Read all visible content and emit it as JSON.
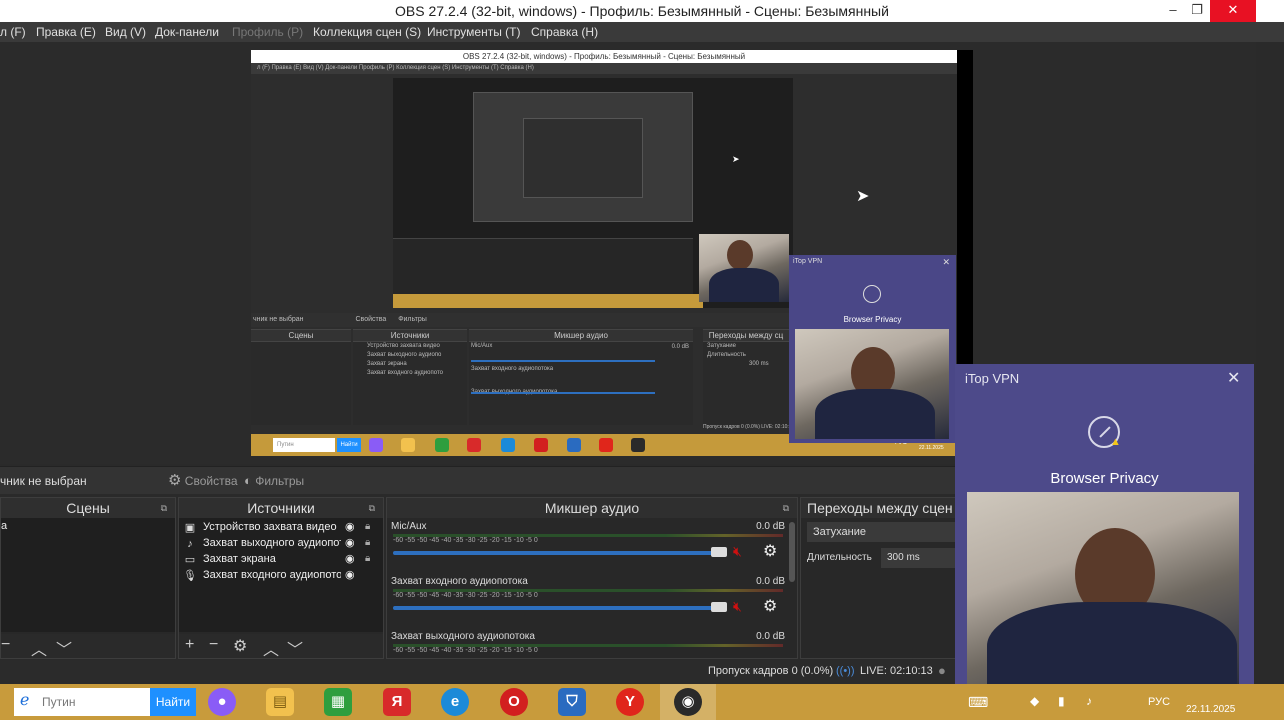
{
  "window": {
    "title": "OBS 27.2.4 (32-bit, windows) - Профиль: Безымянный - Сцены: Безымянный",
    "minimize": "–",
    "restore": "❐",
    "close": "✕"
  },
  "menu": [
    {
      "label": "л (F)",
      "disabled": false
    },
    {
      "label": "Правка (E)",
      "disabled": false
    },
    {
      "label": "Вид (V)",
      "disabled": false
    },
    {
      "label": "Док-панели",
      "disabled": false
    },
    {
      "label": "Профиль (P)",
      "disabled": true
    },
    {
      "label": "Коллекция сцен (S)",
      "disabled": false
    },
    {
      "label": "Инструменты (T)",
      "disabled": false
    },
    {
      "label": "Справка (H)",
      "disabled": false
    }
  ],
  "nested": {
    "title": "OBS 27.2.4 (32-bit, windows) - Профиль: Безымянный - Сцены: Безымянный",
    "menu": "л (F)   Правка (E)   Вид (V)   Док-панели   Профиль (P)   Коллекция сцен (S)   Инструменты (T)   Справка (H)",
    "source_label": "чник не выбран",
    "properties": "Свойства",
    "filters": "Фильтры",
    "scenes": "Сцены",
    "sources": "Источники",
    "mixer": "Микшер аудио",
    "transitions": "Переходы между сц",
    "source_items": [
      "Устройство захвата видео",
      "Захват выходного аудиопо",
      "Захват экрана",
      "Захват входного аудиопото"
    ],
    "mixer_items": [
      "Mic/Aux",
      "Захват входного аудиопотока",
      "Захват выходного аудиопотока"
    ],
    "mixer_db": "0.0 dB",
    "fade": "Затухание",
    "duration_label": "Длительность",
    "duration_value": "300 ms",
    "status": "Пропуск кадров 0 (0.0%)   LIVE: 02:10:13",
    "search": "Путин",
    "find": "Найти",
    "lang": "РУС",
    "date": "22.11.2025"
  },
  "vpn_mid": {
    "title": "iTop VPN",
    "label": "Browser Privacy"
  },
  "sourcebar": {
    "label": "чник не выбран",
    "properties": "Свойства",
    "filters": "Фильтры"
  },
  "docks": {
    "scenes": {
      "title": "Сцены",
      "items": [
        "а"
      ]
    },
    "sources": {
      "title": "Источники",
      "items": [
        {
          "name": "Устройство захвата видео",
          "icon": "camera-icon"
        },
        {
          "name": "Захват выходного аудиопот",
          "icon": "speaker-icon"
        },
        {
          "name": "Захват экрана",
          "icon": "monitor-icon"
        },
        {
          "name": "Захват входного аудиопото",
          "icon": "microphone-icon"
        }
      ]
    },
    "mixer": {
      "title": "Микшер аудио",
      "ticks": "-60  -55  -50  -45  -40  -35  -30  -25  -20  -15  -10  -5  0",
      "channels": [
        {
          "name": "Mic/Aux",
          "db": "0.0 dB"
        },
        {
          "name": "Захват входного аудиопотока",
          "db": "0.0 dB"
        },
        {
          "name": "Захват выходного аудиопотока",
          "db": "0.0 dB"
        }
      ]
    },
    "transitions": {
      "title": "Переходы между сцен",
      "type": "Затухание",
      "duration_label": "Длительность",
      "duration_value": "300 ms"
    }
  },
  "status": {
    "dropped": "Пропуск кадров 0 (0.0%)",
    "live": "LIVE: 02:10:13"
  },
  "vpn": {
    "title": "iTop VPN",
    "label": "Browser Privacy",
    "close": "✕"
  },
  "taskbar": {
    "search_placeholder": "Путин",
    "find": "Найти",
    "lang": "РУС",
    "date": "22.11.2025",
    "apps": [
      {
        "name": "alice-icon",
        "color": "#8a5cf6",
        "glyph": "●"
      },
      {
        "name": "file-explorer-icon",
        "color": "#f2c14e",
        "glyph": "▤"
      },
      {
        "name": "store-icon",
        "color": "#2e9e3e",
        "glyph": "▦"
      },
      {
        "name": "yandex-icon",
        "color": "#d82a2a",
        "glyph": "Я"
      },
      {
        "name": "edge-icon",
        "color": "#1c8ad8",
        "glyph": "e"
      },
      {
        "name": "opera-icon",
        "color": "#d21f1f",
        "glyph": "O"
      },
      {
        "name": "vpn-shield-icon",
        "color": "#2a6bc0",
        "glyph": "⛉"
      },
      {
        "name": "yandex-browser-icon",
        "color": "#e0261b",
        "glyph": "Y"
      },
      {
        "name": "obs-icon",
        "color": "#2a2a2a",
        "glyph": "◉"
      }
    ]
  }
}
